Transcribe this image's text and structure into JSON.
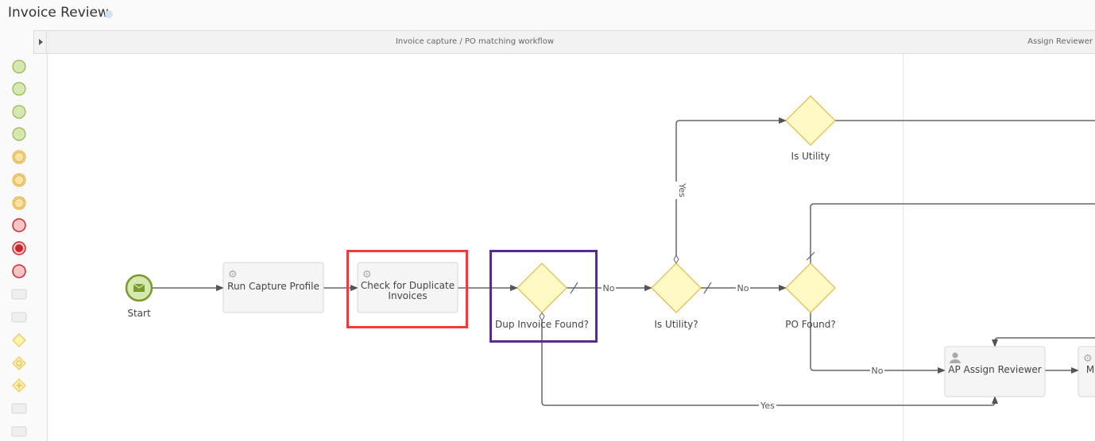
{
  "header": {
    "title": "Invoice Review",
    "info_icon": "info-icon"
  },
  "lanes": [
    {
      "label": "Invoice capture / PO matching workflow"
    },
    {
      "label": "Assign Reviewer"
    }
  ],
  "palette": [
    "start-event",
    "message-start-event",
    "timer-start-event",
    "signal-start-event",
    "escalation-event",
    "intermediate-escalation-event",
    "intermediate-timer-event",
    "end-event",
    "terminate-end-event",
    "error-end-event",
    "user-task",
    "subprocess",
    "exclusive-gateway",
    "inclusive-gateway",
    "parallel-gateway",
    "service-task",
    "script-task"
  ],
  "nodes": {
    "start": "Start",
    "run_capture": "Run Capture Profile",
    "check_dup_1": "Check for Duplicate",
    "check_dup_2": "Invoices",
    "dup_found": "Dup Invoice Found?",
    "is_utility_q": "Is Utility?",
    "po_found": "PO Found?",
    "is_utility": "Is Utility",
    "ap_assign": "AP Assign Reviewer",
    "next_task": "M"
  },
  "edge_labels": {
    "no1": "No",
    "no2": "No",
    "yes_up": "Yes",
    "no3": "No",
    "yes_bottom": "Yes"
  },
  "colors": {
    "highlight_red": "#ef3b3b",
    "highlight_purple": "#5b2a8c",
    "gateway_fill": "#fff9c4",
    "gateway_stroke": "#e0b84a",
    "start_fill": "#d5e8b0",
    "start_stroke": "#7a9a2a"
  }
}
